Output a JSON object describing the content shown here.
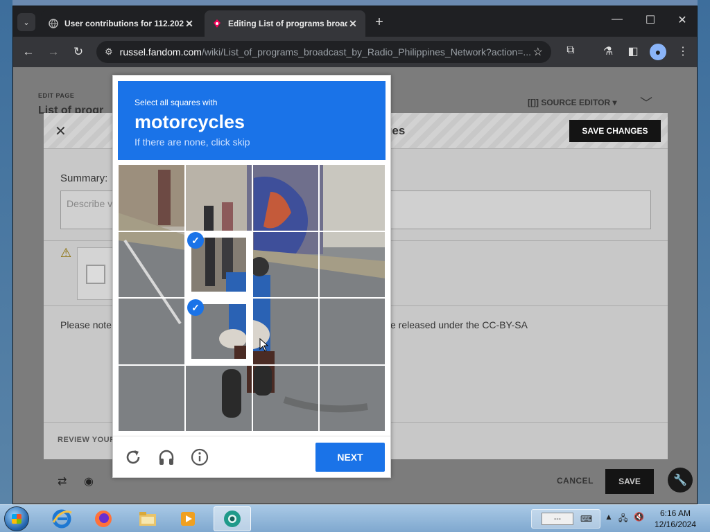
{
  "browser": {
    "tabs": [
      {
        "title": "User contributions for 112.202",
        "active": false
      },
      {
        "title": "Editing List of programs broad",
        "active": true
      }
    ],
    "url_host": "russel.fandom.com",
    "url_path": "/wiki/List_of_programs_broadcast_by_Radio_Philippines_Network?action=..."
  },
  "page": {
    "edit_page_label": "EDIT PAGE",
    "title_fragment": "List of progr",
    "source_editor_label": "SOURCE EDITOR",
    "modal": {
      "title_fragment": "ges",
      "save_changes_label": "SAVE CHANGES",
      "summary_label": "Summary:",
      "summary_placeholder": "Describe v",
      "note_start": "Please note",
      "note_end": "e released under the CC-BY-SA",
      "review_label": "REVIEW YOUR"
    },
    "cancel_label": "CANCEL",
    "save_label": "SAVE"
  },
  "captcha": {
    "instruction": "Select all squares with",
    "target": "motorcycles",
    "skip_hint": "If there are none, click skip",
    "next_label": "NEXT",
    "selected_tiles": [
      4,
      7
    ],
    "accent_color": "#1a73e8"
  },
  "taskbar": {
    "tray_text": "---",
    "time": "6:16 AM",
    "date": "12/16/2024"
  }
}
